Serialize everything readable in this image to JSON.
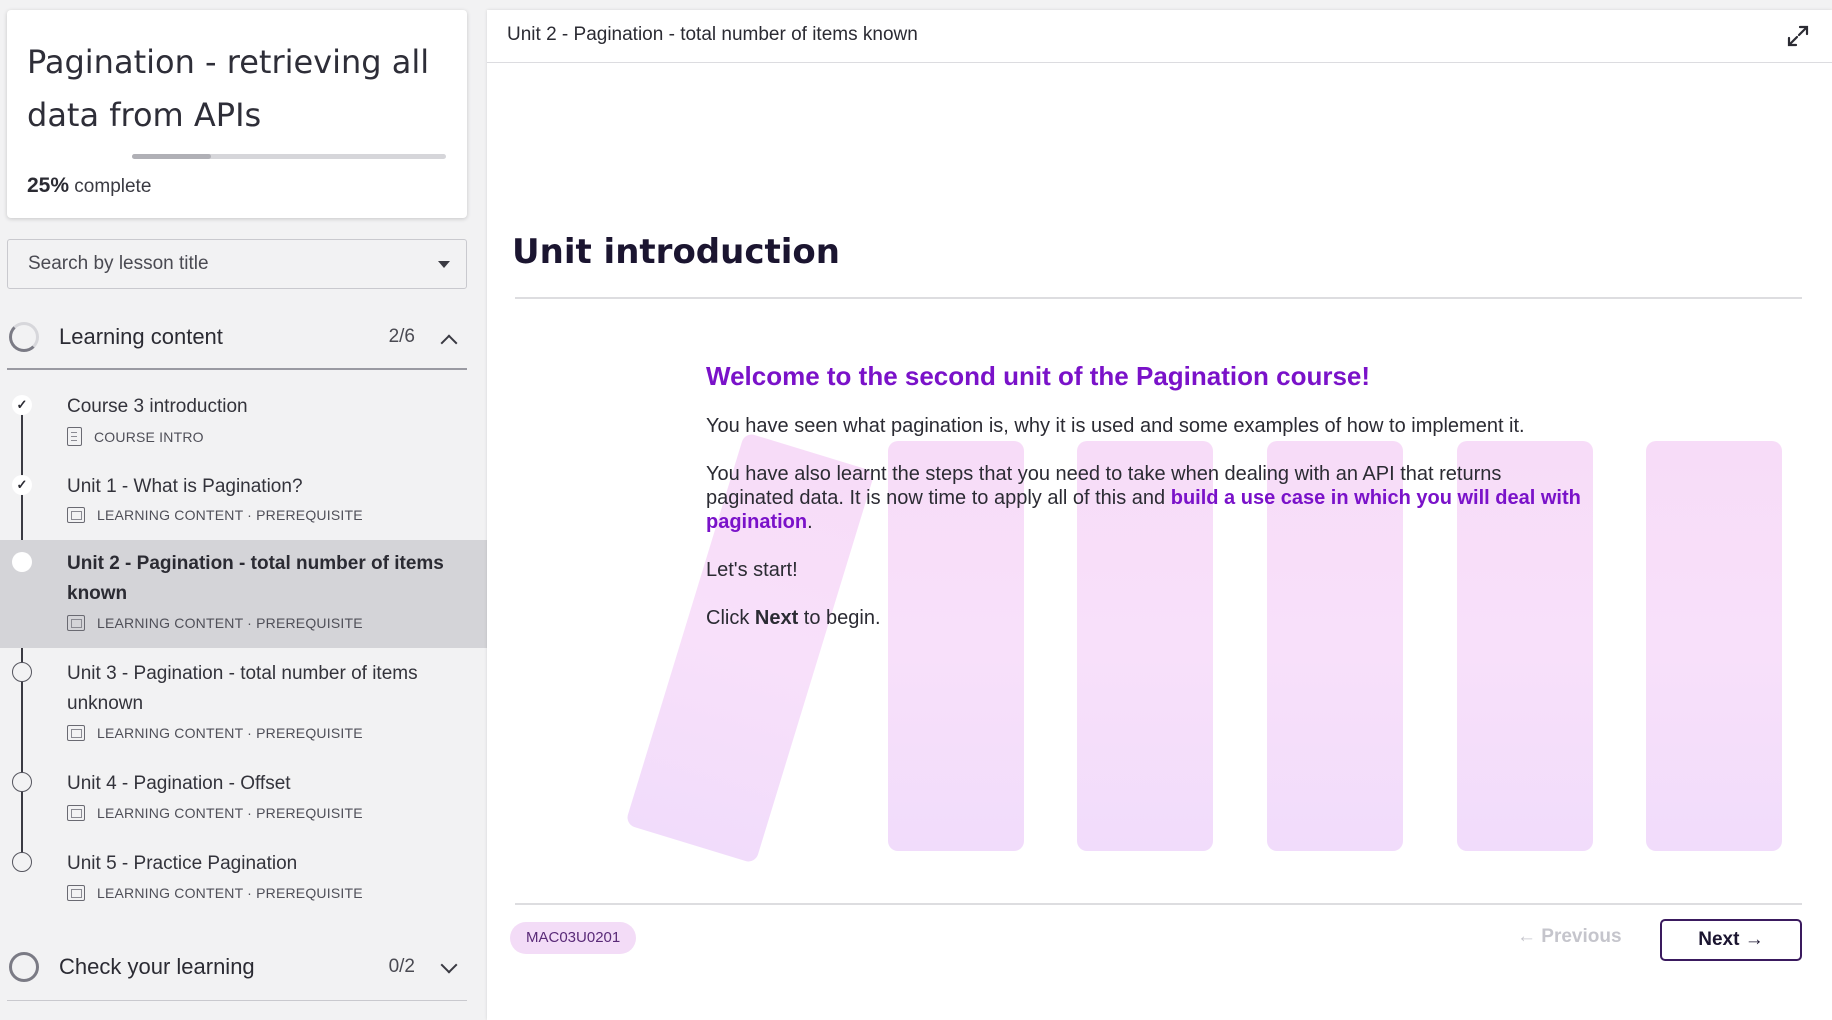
{
  "course": {
    "title": "Pagination - retrieving all data from APIs",
    "progress_percent": 25,
    "progress_value": "25%",
    "progress_suffix": " complete"
  },
  "search": {
    "placeholder": "Search by lesson title"
  },
  "sections": [
    {
      "title": "Learning content",
      "count": "2/6",
      "expanded": true
    },
    {
      "title": "Check your learning",
      "count": "0/2",
      "expanded": false
    }
  ],
  "lessons": [
    {
      "title": "Course 3 introduction",
      "meta": "COURSE INTRO",
      "status": "done",
      "icon": "document-icon"
    },
    {
      "title": "Unit 1 - What is Pagination?",
      "meta": "LEARNING CONTENT · PREREQUISITE",
      "status": "done",
      "icon": "slides-icon"
    },
    {
      "title": "Unit 2 - Pagination - total number of items known",
      "meta": "LEARNING CONTENT · PREREQUISITE",
      "status": "current",
      "icon": "slides-icon"
    },
    {
      "title": "Unit 3 - Pagination - total number of items unknown",
      "meta": "LEARNING CONTENT · PREREQUISITE",
      "status": "todo",
      "icon": "slides-icon"
    },
    {
      "title": "Unit 4 - Pagination - Offset",
      "meta": "LEARNING CONTENT · PREREQUISITE",
      "status": "todo",
      "icon": "slides-icon"
    },
    {
      "title": "Unit 5 - Practice Pagination",
      "meta": "LEARNING CONTENT · PREREQUISITE",
      "status": "todo",
      "icon": "slides-icon"
    }
  ],
  "main": {
    "header_title": "Unit 2 - Pagination - total number of items known",
    "heading": "Unit introduction",
    "welcome": "Welcome to the second unit of the Pagination course!",
    "p1": "You have seen what pagination is, why it is used and some examples of how to implement it.",
    "p2_start": "You have also learnt the steps that you need to take when dealing with an API that returns paginated data. It is now time to apply all of this and ",
    "p2_highlight": "build a use case in which you will deal with pagination",
    "p2_end": ".",
    "p3": "Let's start!",
    "p4_start": "Click ",
    "p4_bold": "Next",
    "p4_end": " to begin.",
    "code": "MAC03U0201",
    "prev_label": "← Previous",
    "next_label": "Next →"
  },
  "colors": {
    "accent": "#7a12c9",
    "badge_bg": "#f3dcf7",
    "active_row": "#d4d4d8",
    "next_border": "#3a1a5e"
  }
}
